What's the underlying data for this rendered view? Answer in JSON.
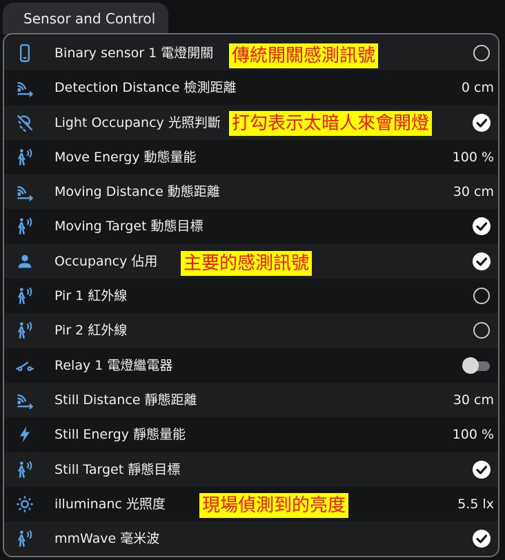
{
  "tab": {
    "label": "Sensor and Control"
  },
  "colors": {
    "icon": "#5aa3e8",
    "annotation_bg": "#ffff00",
    "annotation_text": "#ff1010"
  },
  "rows": [
    {
      "icon": "phone-icon",
      "label": "Binary sensor 1 電燈開關",
      "state": "off"
    },
    {
      "icon": "motion-sensor-distance-icon",
      "label": "Detection Distance 檢測距離",
      "value": "0 cm"
    },
    {
      "icon": "light-off-icon",
      "label": "Light Occupancy 光照判斷",
      "state": "on"
    },
    {
      "icon": "person-motion-icon",
      "label": "Move Energy 動態量能",
      "value": "100 %"
    },
    {
      "icon": "motion-sensor-distance-icon",
      "label": "Moving Distance 動態距離",
      "value": "30 cm"
    },
    {
      "icon": "person-motion-icon",
      "label": "Moving Target 動態目標",
      "state": "on"
    },
    {
      "icon": "account-icon",
      "label": "Occupancy 佔用",
      "state": "on"
    },
    {
      "icon": "person-motion-icon",
      "label": "Pir 1 紅外線",
      "state": "off"
    },
    {
      "icon": "person-motion-icon",
      "label": "Pir 2 紅外線",
      "state": "off"
    },
    {
      "icon": "relay-icon",
      "label": "Relay 1 電燈繼電器",
      "state": "toggle-off"
    },
    {
      "icon": "motion-sensor-distance-icon",
      "label": "Still Distance 靜態距離",
      "value": "30 cm"
    },
    {
      "icon": "lightning-icon",
      "label": "Still Energy 靜態量能",
      "value": "100 %"
    },
    {
      "icon": "person-motion-icon",
      "label": "Still Target 靜態目標",
      "state": "on"
    },
    {
      "icon": "brightness-icon",
      "label": "illuminanc 光照度",
      "value": "5.5 lx"
    },
    {
      "icon": "person-motion-icon",
      "label": "mmWave 毫米波",
      "state": "on"
    }
  ],
  "annotations": [
    "傳統開關感測訊號",
    "打勾表示太暗人來會開燈",
    "主要的感測訊號",
    "現場偵測到的亮度"
  ]
}
